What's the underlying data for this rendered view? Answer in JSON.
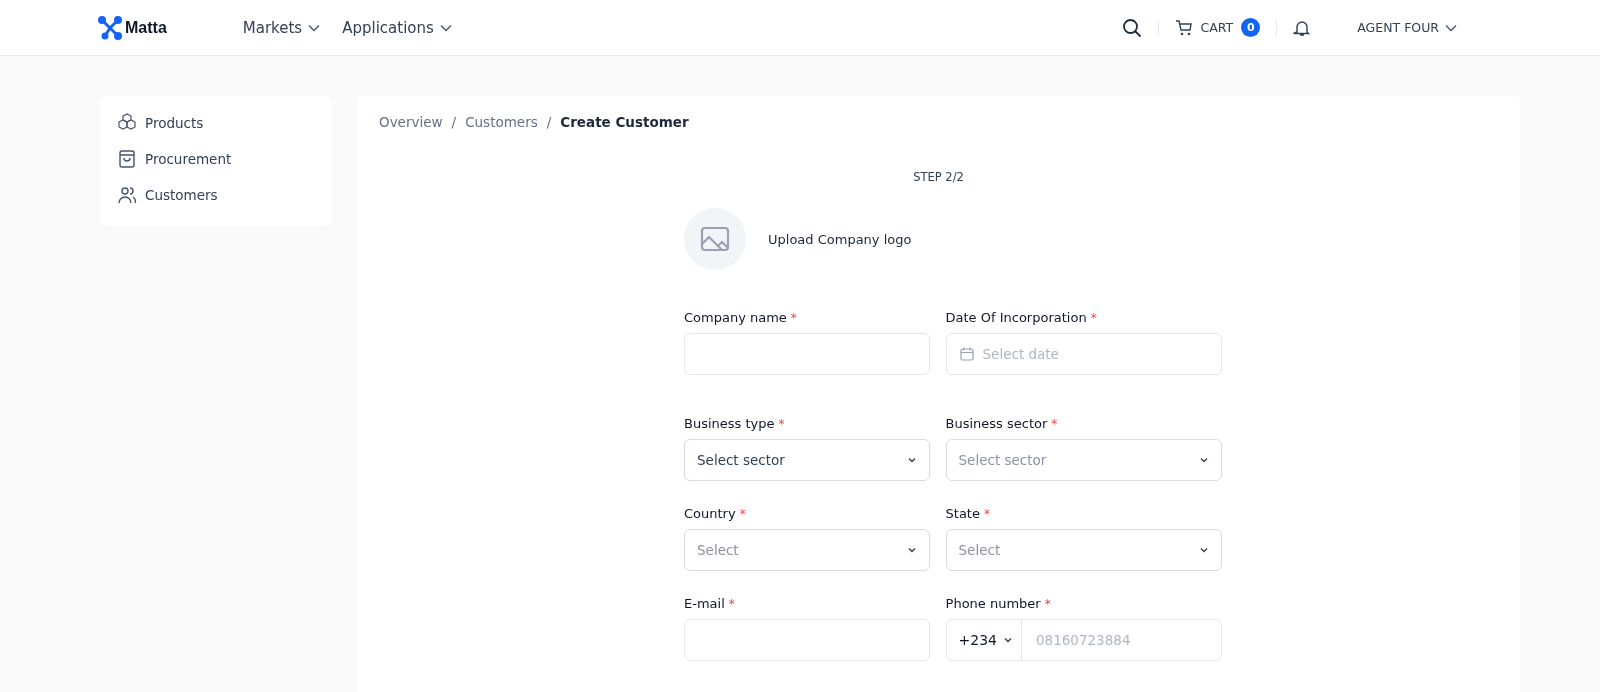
{
  "header": {
    "logo": "Matta",
    "nav": [
      {
        "label": "Markets"
      },
      {
        "label": "Applications"
      }
    ],
    "cart_label": "CART",
    "cart_count": "0",
    "user": "AGENT FOUR"
  },
  "sidebar": {
    "items": [
      {
        "label": "Products"
      },
      {
        "label": "Procurement"
      },
      {
        "label": "Customers"
      }
    ]
  },
  "breadcrumb": [
    {
      "label": "Overview",
      "current": false
    },
    {
      "separator": "/",
      "label": "Customers",
      "current": false
    },
    {
      "separator": "/",
      "label": "Create Customer",
      "current": true
    }
  ],
  "step": "STEP 2/2",
  "upload_label": "Upload Company logo",
  "fields": [
    {
      "kind": "text",
      "label": "Company name",
      "required_mark": "*"
    },
    {
      "kind": "date",
      "label": "Date Of Incorporation",
      "required_mark": "*",
      "placeholder": "Select date"
    },
    {
      "kind": "select",
      "label": "Business type",
      "required_mark": "*",
      "value": "Select sector"
    },
    {
      "kind": "select",
      "label": "Business sector",
      "required_mark": "*",
      "placeholder": "Select sector"
    },
    {
      "kind": "select",
      "label": "Country",
      "required_mark": "*",
      "placeholder": "Select"
    },
    {
      "kind": "select",
      "label": "State",
      "required_mark": "*",
      "placeholder": "Select"
    },
    {
      "kind": "text",
      "label": "E-mail",
      "required_mark": "*"
    },
    {
      "kind": "phone",
      "label": "Phone number",
      "required_mark": "*",
      "code": "+234",
      "placeholder": "08160723884"
    }
  ]
}
